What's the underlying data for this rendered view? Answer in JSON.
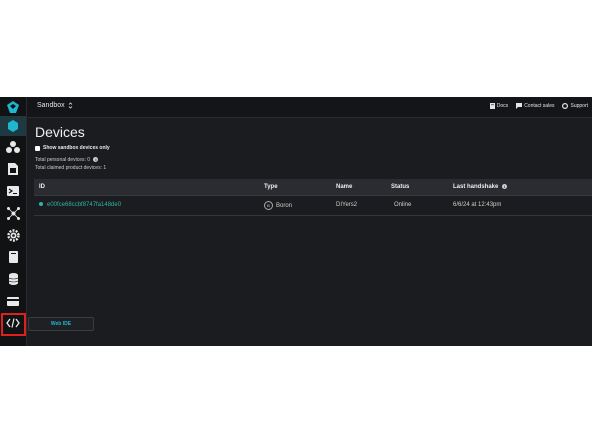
{
  "colors": {
    "accent": "#1fb6cf",
    "online": "#2fb3a8",
    "highlight": "#e0201c"
  },
  "sidebar": {
    "items": [
      {
        "name": "particle-logo-icon",
        "active": false
      },
      {
        "name": "devices-icon",
        "active": true
      },
      {
        "name": "products-icon",
        "active": false
      },
      {
        "name": "sim-card-icon",
        "active": false
      },
      {
        "name": "console-icon",
        "active": false
      },
      {
        "name": "integrations-icon",
        "active": false
      },
      {
        "name": "settings-icon",
        "active": false
      },
      {
        "name": "billing-icon",
        "active": false
      },
      {
        "name": "database-icon",
        "active": false
      },
      {
        "name": "card-icon",
        "active": false
      },
      {
        "name": "code-icon",
        "active": false
      }
    ],
    "tooltip": "Web IDE"
  },
  "topbar": {
    "org": "Sandbox",
    "docs": "Docs",
    "contact": "Contact sales",
    "support": "Support"
  },
  "page": {
    "title": "Devices",
    "sandbox_toggle": "Show sandbox devices only",
    "personal_devices": "Total personal devices: 0",
    "claimed_devices": "Total claimed product devices: 1"
  },
  "table": {
    "headers": {
      "id": "ID",
      "type": "Type",
      "name": "Name",
      "status": "Status",
      "last_handshake": "Last handshake"
    },
    "rows": [
      {
        "id": "e00fce68ccbf8747fa148de0",
        "type_icon": "B",
        "type": "Boron",
        "name": "DIYers2",
        "status": "Online",
        "last_handshake": "6/6/24 at 12:43pm"
      }
    ]
  }
}
